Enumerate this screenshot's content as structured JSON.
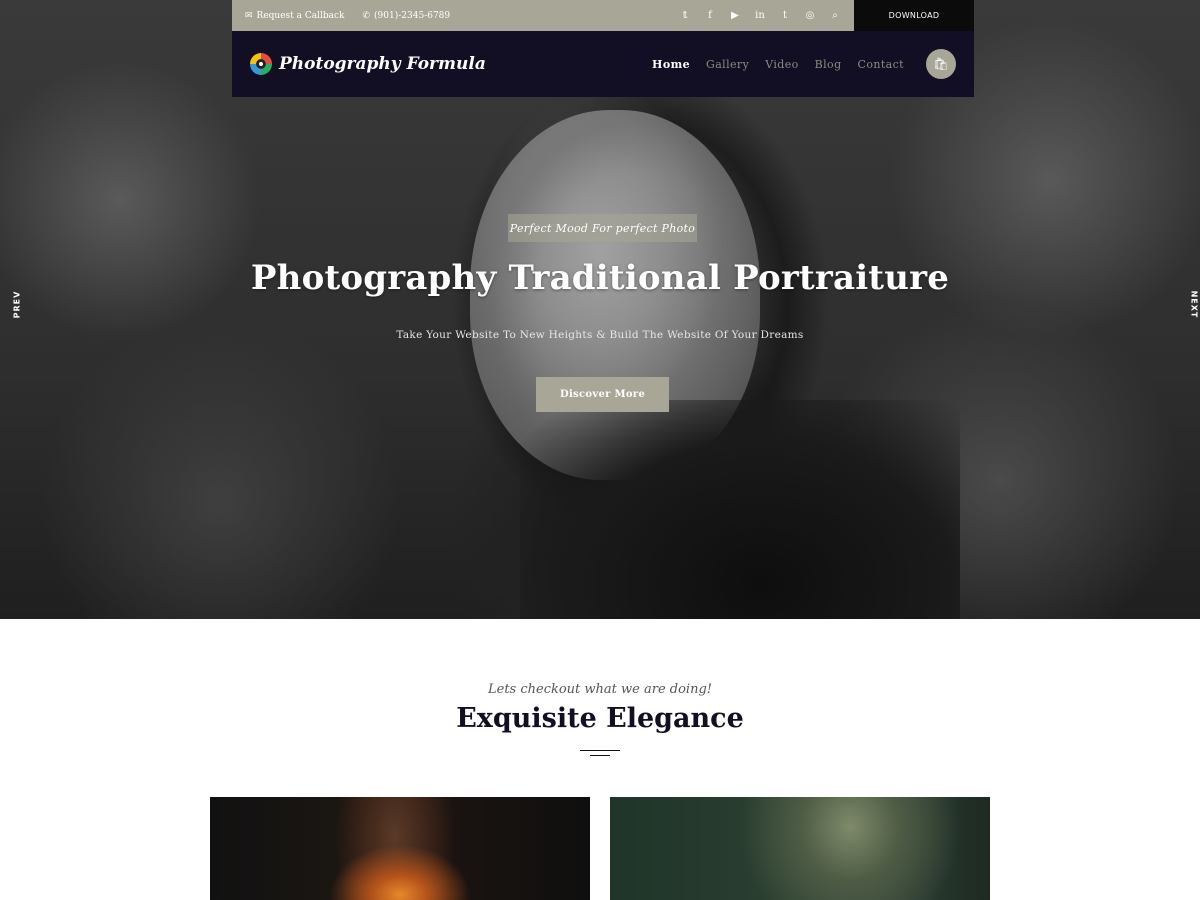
{
  "topbar": {
    "callback_label": "Request a Callback",
    "phone": "(901)-2345-6789",
    "socials": [
      {
        "name": "twitter-icon",
        "glyph": "𝕥"
      },
      {
        "name": "facebook-icon",
        "glyph": "f"
      },
      {
        "name": "youtube-icon",
        "glyph": "▶"
      },
      {
        "name": "linkedin-icon",
        "glyph": "in"
      },
      {
        "name": "tumblr-icon",
        "glyph": "t"
      },
      {
        "name": "instagram-icon",
        "glyph": "◎"
      },
      {
        "name": "search-icon",
        "glyph": "⌕"
      }
    ],
    "download_label": "DOWNLOAD"
  },
  "navbar": {
    "logo_text": "Photography Formula",
    "menu": [
      "Home",
      "Gallery",
      "Video",
      "Blog",
      "Contact"
    ],
    "active_menu": "Home"
  },
  "hero": {
    "tag": "Perfect Mood For perfect Photo",
    "title": "Photography Traditional Portraiture",
    "subtitle": "Take Your Website To New Heights & Build The Website Of Your Dreams",
    "button_label": "Discover More",
    "prev_label": "PREV",
    "next_label": "NEXT"
  },
  "section": {
    "kicker": "Lets checkout what we are doing!",
    "title": "Exquisite Elegance"
  },
  "colors": {
    "accent": "#a8a797",
    "navbar_bg": "#120f24",
    "download_bg": "#0b0b0b"
  }
}
